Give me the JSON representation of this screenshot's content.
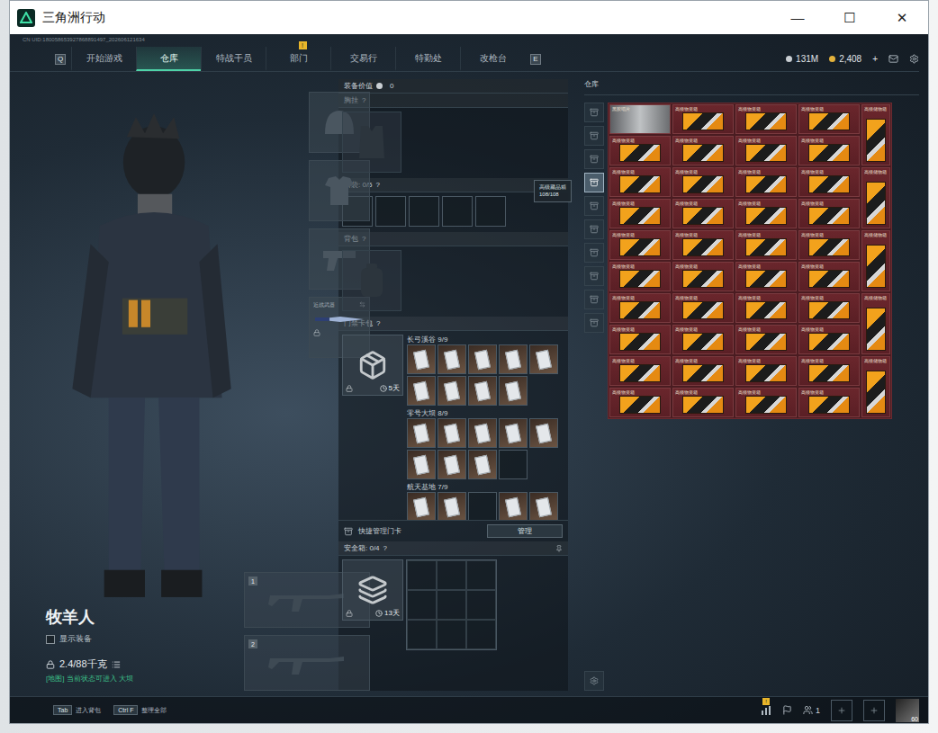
{
  "window": {
    "title": "三角洲行动",
    "controls": [
      "—",
      "☐",
      "✕"
    ]
  },
  "uid": "CN UID:180058653927868891497_202606121634",
  "nav": {
    "left_key": "Q",
    "right_key": "E",
    "tabs": [
      {
        "label": "开始游戏",
        "selected": false,
        "badge": ""
      },
      {
        "label": "仓库",
        "selected": true,
        "badge": ""
      },
      {
        "label": "特战干员",
        "selected": false,
        "badge": ""
      },
      {
        "label": "部门",
        "selected": false,
        "badge": "!"
      },
      {
        "label": "交易行",
        "selected": false,
        "badge": ""
      },
      {
        "label": "特勤处",
        "selected": false,
        "badge": ""
      },
      {
        "label": "改枪台",
        "selected": false,
        "badge": ""
      }
    ]
  },
  "currency": [
    {
      "value": "131M",
      "kind": "silver"
    },
    {
      "value": "2,408",
      "kind": "gold"
    }
  ],
  "topup": "+",
  "operator": {
    "name": "牧羊人",
    "show_gear": {
      "label": "显示装备",
      "checked": false
    },
    "weight": "2.4/88千克",
    "status": "[地图] 当前状态可进入 大坝"
  },
  "gear": {
    "melee_label": "近战武器",
    "weapon_slots": [
      "1",
      "2"
    ]
  },
  "loadout": {
    "value_label": "装备价值",
    "value": "0",
    "help": "?",
    "chest": "胸挂",
    "pockets": "口袋: 0/5",
    "pocket_slots": 5,
    "backpack": "背包",
    "card_case": {
      "label": "门禁卡包",
      "duration": "5天",
      "groups": [
        {
          "name": "长弓溪谷 9/9",
          "cards": [
            {
              "filled": true
            },
            {
              "filled": true
            },
            {
              "filled": true
            },
            {
              "filled": true
            },
            {
              "filled": true
            },
            {
              "filled": true
            },
            {
              "filled": true
            },
            {
              "filled": true
            },
            {
              "filled": true
            }
          ]
        },
        {
          "name": "零号大坝 8/9",
          "cards": [
            {
              "filled": true
            },
            {
              "filled": true
            },
            {
              "filled": true
            },
            {
              "filled": true
            },
            {
              "filled": true
            },
            {
              "filled": true
            },
            {
              "filled": true
            },
            {
              "filled": true
            },
            {
              "filled": false
            }
          ]
        },
        {
          "name": "航天基地 7/9",
          "cards": [
            {
              "filled": true
            },
            {
              "filled": true
            },
            {
              "filled": false
            },
            {
              "filled": true
            },
            {
              "filled": true
            },
            {
              "filled": true
            },
            {
              "filled": true
            },
            {
              "filled": true
            },
            {
              "filled": false
            }
          ]
        }
      ]
    },
    "manage": {
      "label": "快捷管理门卡",
      "button": "管理"
    },
    "safe_box": {
      "label": "安全箱: 0/4",
      "duration": "13天",
      "cells": 9
    }
  },
  "tooltip": {
    "title": "高级藏品箱",
    "count": "108/108"
  },
  "storage": {
    "title": "仓库",
    "tabs": [
      {
        "selected": false
      },
      {
        "selected": false
      },
      {
        "selected": false
      },
      {
        "selected": true
      },
      {
        "selected": false
      },
      {
        "selected": false
      },
      {
        "selected": false
      },
      {
        "selected": false
      },
      {
        "selected": false
      },
      {
        "selected": false
      }
    ],
    "items": [
      {
        "label": "黑胶唱片",
        "kind": "photo"
      },
      {
        "label": "高级物资箱",
        "kind": "box"
      },
      {
        "label": "高级物资箱",
        "kind": "box"
      },
      {
        "label": "高级物资箱",
        "kind": "box"
      },
      {
        "label": "高级物资箱",
        "kind": "box"
      },
      {
        "label": "高级物资箱",
        "kind": "box"
      },
      {
        "label": "高级物资箱",
        "kind": "box"
      },
      {
        "label": "高级物资箱",
        "kind": "box"
      },
      {
        "label": "高级物资箱",
        "kind": "box"
      },
      {
        "label": "高级物资箱",
        "kind": "box"
      },
      {
        "label": "高级物资箱",
        "kind": "box"
      },
      {
        "label": "高级物资箱",
        "kind": "box"
      },
      {
        "label": "高级物资箱",
        "kind": "box"
      },
      {
        "label": "高级物资箱",
        "kind": "box"
      },
      {
        "label": "高级物资箱",
        "kind": "box"
      },
      {
        "label": "高级物资箱",
        "kind": "box"
      },
      {
        "label": "高级物资箱",
        "kind": "box"
      },
      {
        "label": "高级物资箱",
        "kind": "box"
      },
      {
        "label": "高级物资箱",
        "kind": "box"
      },
      {
        "label": "高级物资箱",
        "kind": "box"
      },
      {
        "label": "高级物资箱",
        "kind": "box"
      },
      {
        "label": "高级物资箱",
        "kind": "box"
      },
      {
        "label": "高级物资箱",
        "kind": "box"
      },
      {
        "label": "高级物资箱",
        "kind": "box"
      },
      {
        "label": "高级物资箱",
        "kind": "box"
      },
      {
        "label": "高级物资箱",
        "kind": "box"
      },
      {
        "label": "高级物资箱",
        "kind": "box"
      },
      {
        "label": "高级物资箱",
        "kind": "box"
      },
      {
        "label": "高级物资箱",
        "kind": "box"
      },
      {
        "label": "高级物资箱",
        "kind": "box"
      },
      {
        "label": "高级物资箱",
        "kind": "box"
      },
      {
        "label": "高级物资箱",
        "kind": "box"
      },
      {
        "label": "高级物资箱",
        "kind": "box"
      },
      {
        "label": "高级物资箱",
        "kind": "box"
      },
      {
        "label": "高级物资箱",
        "kind": "box"
      },
      {
        "label": "高级物资箱",
        "kind": "box"
      },
      {
        "label": "高级物资箱",
        "kind": "box"
      },
      {
        "label": "高级物资箱",
        "kind": "box"
      },
      {
        "label": "高级物资箱",
        "kind": "box"
      },
      {
        "label": "高级物资箱",
        "kind": "box"
      }
    ],
    "tall_items": [
      "高级储物箱",
      "高级储物箱",
      "高级储物箱",
      "高级储物箱",
      "高级储物箱"
    ]
  },
  "bottom": {
    "hints": [
      {
        "key": "Tab",
        "label": "进入背包"
      },
      {
        "key": "Ctrl F",
        "label": "整理全部"
      }
    ],
    "chart_badge": "!",
    "friends": "1",
    "level": "60"
  }
}
